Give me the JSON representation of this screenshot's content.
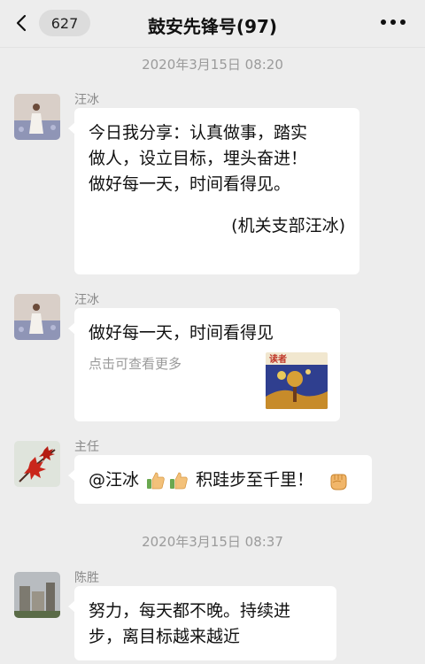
{
  "header": {
    "unread_count": "627",
    "title": "鼓安先锋号(97)"
  },
  "timestamps": [
    "2020年3月15日 08:20",
    "2020年3月15日 08:37"
  ],
  "messages": [
    {
      "sender": "汪冰",
      "lines": [
        "今日我分享：认真做事，踏实",
        "做人，设立目标，埋头奋进！",
        "做好每一天，时间看得见。"
      ],
      "signature": "(机关支部汪冰)"
    },
    {
      "sender": "汪冰",
      "card_title": "做好每一天，时间看得见",
      "card_subtitle": "点击可查看更多",
      "thumb_text": "读者"
    },
    {
      "sender": "主任",
      "mention": "@汪冰",
      "text": "积跬步至千里！"
    },
    {
      "sender": "陈胜",
      "lines": [
        "努力，每天都不晚。持续进",
        "步，离目标越来越近"
      ]
    }
  ],
  "icons": {
    "back": "chevron-left-icon",
    "more": "more-dots-icon",
    "thumbs_up": "thumbs-up-emoji",
    "fist": "fist-emoji"
  },
  "colors": {
    "background": "#ededed",
    "bubble": "#ffffff",
    "timestamp": "#9b9b9b"
  }
}
